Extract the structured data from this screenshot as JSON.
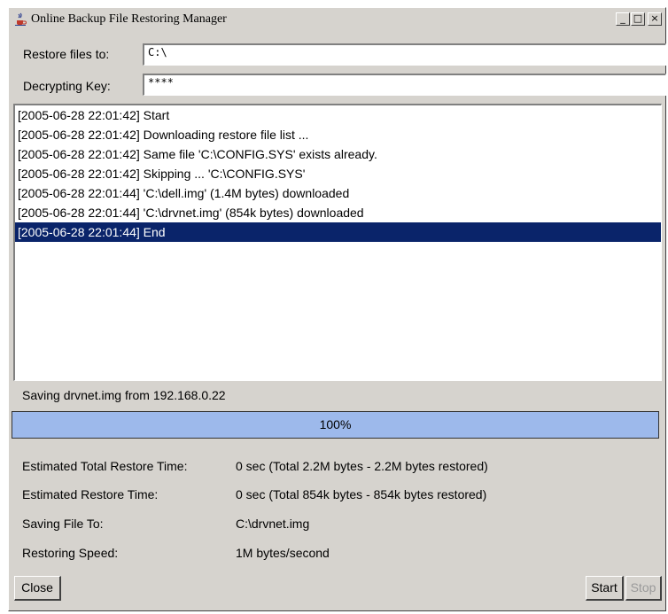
{
  "window": {
    "title": "Online Backup File Restoring Manager",
    "controls": {
      "minimize": "_",
      "maximize": "□",
      "close": "×"
    }
  },
  "form": {
    "restore_to_label": "Restore files to:",
    "restore_to_value": "C:\\",
    "key_label": "Decrypting Key:",
    "key_value": "****"
  },
  "log": [
    "[2005-06-28 22:01:42] Start",
    "[2005-06-28 22:01:42] Downloading restore file list ...",
    "[2005-06-28 22:01:42] Same file 'C:\\CONFIG.SYS' exists already.",
    "[2005-06-28 22:01:42] Skipping ... 'C:\\CONFIG.SYS'",
    "[2005-06-28 22:01:44] 'C:\\dell.img' (1.4M bytes) downloaded",
    "[2005-06-28 22:01:44] 'C:\\drvnet.img' (854k bytes) downloaded",
    "[2005-06-28 22:01:44] End"
  ],
  "selected_log_index": 6,
  "status": {
    "saving_text": "Saving drvnet.img from 192.168.0.22",
    "progress_text": "100%",
    "progress_value": 100
  },
  "details": {
    "total_time_label": "Estimated Total Restore Time:",
    "total_time_value": "0 sec (Total 2.2M bytes - 2.2M bytes restored)",
    "restore_time_label": "Estimated Restore Time:",
    "restore_time_value": "0 sec (Total 854k bytes - 854k bytes restored)",
    "saving_to_label": "Saving File To:",
    "saving_to_value": "C:\\drvnet.img",
    "speed_label": "Restoring Speed:",
    "speed_value": "1M bytes/second"
  },
  "buttons": {
    "close": "Close",
    "start": "Start",
    "stop": "Stop"
  },
  "colors": {
    "selection": "#0a246a",
    "progress": "#9db9eb",
    "window_bg": "#d6d3ce"
  }
}
